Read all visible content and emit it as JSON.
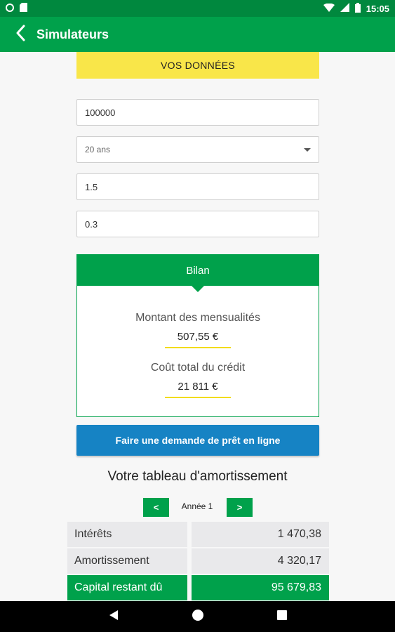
{
  "status_bar": {
    "time": "15:05"
  },
  "app_bar": {
    "title": "Simulateurs"
  },
  "banner": {
    "label": "VOS DONNÉES"
  },
  "form": {
    "amount": "100000",
    "duration": "20 ans",
    "rate": "1.5",
    "insurance": "0.3"
  },
  "bilan": {
    "title": "Bilan",
    "monthly_label": "Montant des mensualités",
    "monthly_value": "507,55 €",
    "cost_label": "Coût total du crédit",
    "cost_value": "21 811 €"
  },
  "cta": {
    "label": "Faire une demande de prêt en ligne"
  },
  "amortization": {
    "title": "Votre tableau d'amortissement",
    "prev_label": "<",
    "next_label": ">",
    "year_label": "Année 1",
    "rows": [
      {
        "label": "Intérêts",
        "value": "1 470,38"
      },
      {
        "label": "Amortissement",
        "value": "4 320,17"
      },
      {
        "label": "Capital restant dû",
        "value": "95 679,83"
      }
    ]
  },
  "colors": {
    "primary_green": "#00a14b",
    "status_green": "#00883e",
    "banner_yellow": "#f9e649",
    "cta_blue": "#1683c4"
  }
}
